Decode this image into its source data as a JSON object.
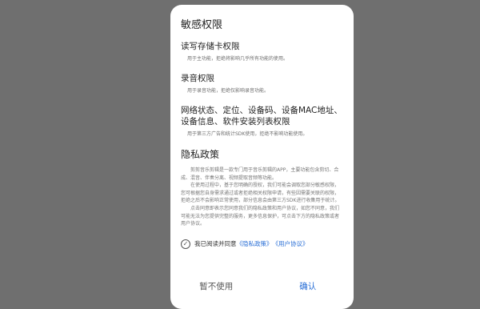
{
  "dialog": {
    "title": "敏感权限",
    "permissions": [
      {
        "title": "读写存储卡权限",
        "desc": "用于主功能，拒绝将影响几乎所有功能的使用。"
      },
      {
        "title": "录音权限",
        "desc": "用于录音功能，拒绝仅影响录音功能。"
      },
      {
        "title": "网络状态、定位、设备码、设备MAC地址、设备信息、软件安装列表权限",
        "desc": "用于第三方广告和统计SDK使用，拒绝不影响功能使用。"
      }
    ],
    "privacy_title": "隐私政策",
    "privacy_paragraphs": [
      "剪剪音乐剪辑是一款专门用于音乐剪辑的APP，主要功能包含剪切、合成、混音、伴奏分离、视频提取音频等功能。",
      "在使用过程中，基于您明确的授权，我们可能会调取您部分敏感权限，您可根据您自身需求通过或者拒绝相关权限申请，有些因需要关联的权限，拒绝之后不会影响正常使用，部分信息会由第三方SDK进行收集用于统计。",
      "点击同意即表示您同意我们的隐私政策和用户协议，如您不同意，我们可能无法为您提供完整的服务，更多信息保护，可点击下方的隐私政策或者用户协议。"
    ],
    "consent": {
      "checkbox_glyph": "✓",
      "text": "我已阅读并同意",
      "privacy_link": "《隐私政策》",
      "terms_link": "《用户协议》"
    },
    "buttons": {
      "cancel": "暂不使用",
      "confirm": "确认"
    },
    "colors": {
      "link": "#2a6fd6",
      "overlay": "#6f6f6f",
      "dialog_bg": "#ffffff"
    }
  }
}
